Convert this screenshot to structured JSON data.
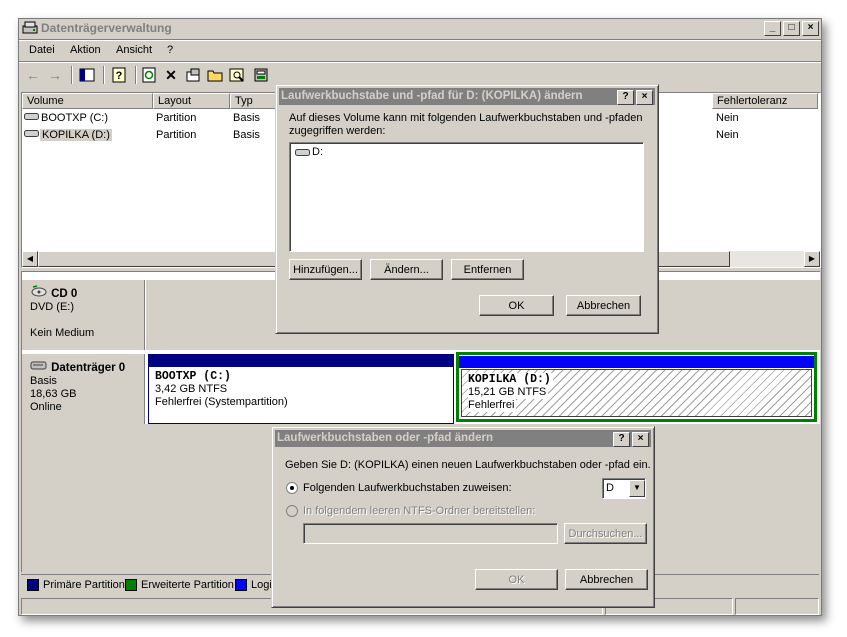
{
  "window": {
    "title": "Datenträgerverwaltung",
    "buttons": {
      "minimize": "_",
      "maximize": "□",
      "close": "×"
    }
  },
  "menu": [
    "Datei",
    "Aktion",
    "Ansicht",
    "?"
  ],
  "toolbar": [
    "back-arrow-icon",
    "forward-arrow-icon",
    "show-hide-tree-icon",
    "help-icon",
    "refresh-icon",
    "delete-icon",
    "properties-icon",
    "open-folder-icon",
    "explore-icon",
    "disk-properties-icon"
  ],
  "volume_list": {
    "columns": [
      "Volume",
      "Layout",
      "Typ",
      "Fehlertoleranz"
    ],
    "rows": [
      {
        "volume": "BOOTXP (C:)",
        "layout": "Partition",
        "typ": "Basis",
        "fehlertoleranz": "Nein"
      },
      {
        "volume": "KOPILKA (D:)",
        "layout": "Partition",
        "typ": "Basis",
        "fehlertoleranz": "Nein"
      }
    ]
  },
  "disks": [
    {
      "name": "CD 0",
      "type": "DVD (E:)",
      "status": "Kein Medium"
    },
    {
      "name": "Datenträger 0",
      "type": "Basis",
      "size": "18,63 GB",
      "status": "Online",
      "partitions": [
        {
          "name": "BOOTXP  (C:)",
          "size": "3,42 GB NTFS",
          "status": "Fehlerfrei (Systempartition)",
          "bar_color": "#000080"
        },
        {
          "name": "KOPILKA  (D:)",
          "size": "15,21 GB NTFS",
          "status": "Fehlerfrei",
          "bar_color": "#0000ff",
          "selected": true
        }
      ]
    }
  ],
  "legend": [
    {
      "label": "Primäre Partition",
      "color": "#000080"
    },
    {
      "label": "Erweiterte Partition",
      "color": "#008000"
    },
    {
      "label": "Logis",
      "color": "#0000ff"
    }
  ],
  "dialog1": {
    "title": "Laufwerkbuchstabe und -pfad für D: (KOPILKA) ändern",
    "help_btn": "?",
    "close_btn": "×",
    "desc": "Auf dieses Volume kann mit folgenden Laufwerkbuchstaben und -pfaden zugegriffen werden:",
    "list_item": "D:",
    "btn_add": "Hinzufügen...",
    "btn_change": "Ändern...",
    "btn_remove": "Entfernen",
    "btn_ok": "OK",
    "btn_cancel": "Abbrechen"
  },
  "dialog2": {
    "title": "Laufwerkbuchstaben oder -pfad ändern",
    "help_btn": "?",
    "close_btn": "×",
    "desc": "Geben Sie D: (KOPILKA) einen neuen Laufwerkbuchstaben oder -pfad ein.",
    "radio1_label": "Folgenden Laufwerkbuchstaben zuweisen:",
    "drive_letter": "D",
    "radio2_label": "In folgendem leeren NTFS-Ordner bereitstellen:",
    "folder_value": "",
    "btn_browse": "Durchsuchen...",
    "btn_ok": "OK",
    "btn_cancel": "Abbrechen"
  }
}
